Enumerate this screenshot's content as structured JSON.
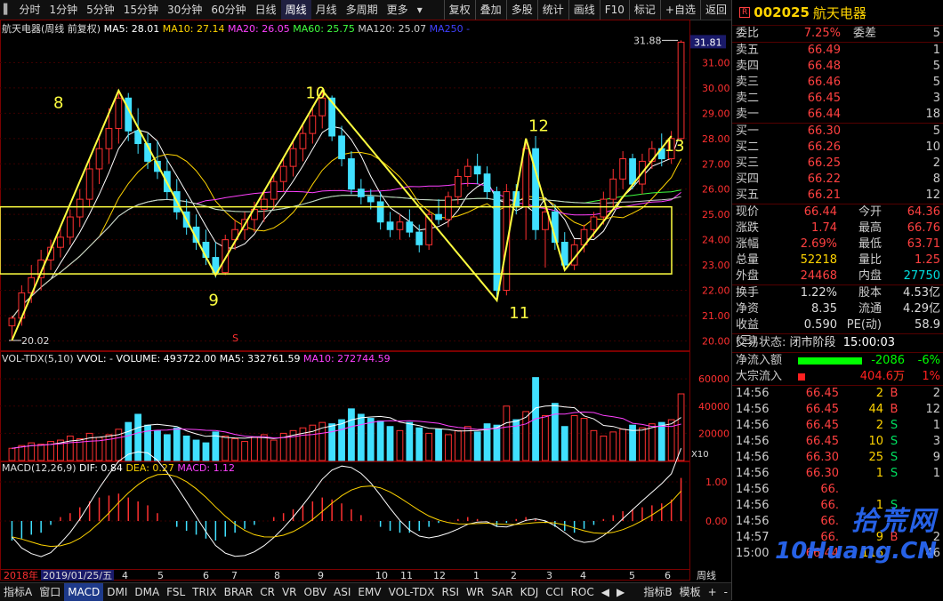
{
  "toolbar": {
    "items": [
      "分时",
      "1分钟",
      "5分钟",
      "15分钟",
      "30分钟",
      "60分钟",
      "日线",
      "周线",
      "月线",
      "多周期",
      "更多"
    ],
    "active": "周线",
    "right": [
      "复权",
      "叠加",
      "多股",
      "统计",
      "画线",
      "F10",
      "标记",
      "+自选",
      "返回"
    ]
  },
  "stock": {
    "code": "002025",
    "name": "航天电器",
    "badge": "R"
  },
  "main_legend": {
    "title": "航天电器(周线 前复权)",
    "items": [
      {
        "label": "MA5: 28.01",
        "color": "#ffffff"
      },
      {
        "label": "MA10: 27.14",
        "color": "#ffd400"
      },
      {
        "label": "MA20: 26.05",
        "color": "#ff40ff"
      },
      {
        "label": "MA60: 25.75",
        "color": "#40ff40"
      },
      {
        "label": "MA120: 25.07",
        "color": "#cccccc"
      },
      {
        "label": "MA250 -",
        "color": "#4040ff"
      }
    ]
  },
  "vol_legend": {
    "title": "VOL-TDX(5,10)",
    "items": [
      {
        "label": "VVOL: -",
        "color": "#ffffff"
      },
      {
        "label": "VOLUME: 493722.00",
        "color": "#ffffff"
      },
      {
        "label": "MA5: 332761.59",
        "color": "#ffffff"
      },
      {
        "label": "MA10: 272744.59",
        "color": "#ff40ff"
      }
    ]
  },
  "macd_legend": {
    "title": "MACD(12,26,9)",
    "items": [
      {
        "label": "DIF: 0.84",
        "color": "#ffffff"
      },
      {
        "label": "DEA: 0.27",
        "color": "#ffd400"
      },
      {
        "label": "MACD: 1.12",
        "color": "#ff40ff"
      }
    ]
  },
  "chart_data": {
    "type": "candlestick",
    "price_axis": {
      "ticks": [
        20,
        21,
        22,
        23,
        24,
        25,
        26,
        27,
        28,
        29,
        30,
        31
      ],
      "max_label": "31.88",
      "min_label": "20.02",
      "current": "31.81"
    },
    "vol_axis": {
      "ticks": [
        "20000",
        "40000",
        "60000"
      ],
      "unit": "X10"
    },
    "macd_axis": {
      "ticks": [
        "0.00",
        "1.00"
      ]
    },
    "x_labels": [
      "2018年",
      "2019/01/25/五",
      "4",
      "5",
      "6",
      "7",
      "8",
      "9",
      "10",
      "11",
      "12",
      "1",
      "2",
      "3",
      "4",
      "5",
      "6"
    ],
    "annotations": [
      "8",
      "9",
      "10",
      "11",
      "12",
      "13"
    ],
    "marker": "S",
    "candles": [
      [
        20.6,
        21.0,
        20.0,
        20.9
      ],
      [
        20.9,
        22.2,
        20.6,
        21.9
      ],
      [
        21.9,
        23.0,
        21.5,
        22.5
      ],
      [
        22.5,
        23.6,
        22.0,
        23.2
      ],
      [
        23.2,
        24.0,
        22.8,
        23.7
      ],
      [
        23.7,
        24.5,
        23.3,
        24.1
      ],
      [
        24.1,
        25.2,
        23.8,
        24.9
      ],
      [
        24.9,
        26.0,
        24.5,
        25.6
      ],
      [
        25.6,
        27.2,
        25.3,
        26.8
      ],
      [
        26.8,
        28.0,
        26.2,
        27.6
      ],
      [
        27.6,
        29.2,
        27.0,
        28.4
      ],
      [
        28.4,
        29.9,
        27.8,
        29.6
      ],
      [
        29.6,
        29.8,
        27.9,
        28.3
      ],
      [
        28.3,
        29.2,
        27.4,
        27.8
      ],
      [
        27.8,
        28.2,
        26.8,
        27.1
      ],
      [
        27.1,
        27.9,
        26.4,
        26.7
      ],
      [
        26.7,
        27.2,
        25.6,
        25.9
      ],
      [
        25.9,
        26.4,
        24.8,
        25.1
      ],
      [
        25.1,
        25.6,
        24.2,
        24.5
      ],
      [
        24.5,
        25.0,
        23.6,
        23.9
      ],
      [
        23.9,
        24.4,
        23.0,
        23.3
      ],
      [
        23.3,
        23.9,
        22.5,
        22.7
      ],
      [
        22.7,
        24.2,
        22.6,
        24.0
      ],
      [
        24.0,
        24.8,
        23.6,
        24.4
      ],
      [
        24.4,
        25.1,
        24.0,
        24.8
      ],
      [
        24.8,
        25.5,
        24.3,
        25.2
      ],
      [
        25.2,
        25.9,
        24.7,
        25.6
      ],
      [
        25.6,
        26.6,
        25.2,
        26.3
      ],
      [
        26.3,
        27.2,
        25.9,
        26.9
      ],
      [
        26.9,
        27.9,
        26.5,
        27.6
      ],
      [
        27.6,
        28.6,
        27.1,
        28.2
      ],
      [
        28.2,
        29.3,
        27.8,
        28.9
      ],
      [
        28.9,
        29.9,
        28.4,
        29.6
      ],
      [
        29.6,
        29.7,
        27.9,
        28.1
      ],
      [
        28.1,
        28.5,
        26.9,
        27.2
      ],
      [
        27.2,
        27.5,
        25.8,
        26.0
      ],
      [
        26.0,
        26.4,
        25.4,
        25.7
      ],
      [
        25.7,
        26.0,
        25.2,
        25.5
      ],
      [
        25.5,
        25.9,
        24.4,
        24.7
      ],
      [
        24.7,
        25.1,
        24.1,
        24.4
      ],
      [
        24.4,
        25.0,
        24.0,
        24.7
      ],
      [
        24.7,
        25.2,
        24.1,
        24.3
      ],
      [
        24.3,
        24.6,
        23.5,
        23.8
      ],
      [
        23.8,
        25.2,
        23.6,
        25.0
      ],
      [
        25.0,
        25.6,
        24.6,
        24.8
      ],
      [
        24.8,
        25.9,
        24.5,
        25.7
      ],
      [
        25.7,
        26.8,
        25.4,
        26.5
      ],
      [
        26.5,
        27.2,
        26.1,
        26.9
      ],
      [
        26.9,
        27.4,
        26.2,
        26.6
      ],
      [
        26.6,
        26.9,
        25.6,
        25.9
      ],
      [
        25.9,
        26.1,
        21.6,
        22.0
      ],
      [
        22.0,
        26.2,
        21.8,
        25.9
      ],
      [
        25.9,
        26.2,
        25.0,
        25.3
      ],
      [
        25.3,
        27.9,
        24.0,
        27.6
      ],
      [
        27.6,
        28.1,
        24.0,
        24.4
      ],
      [
        24.4,
        25.3,
        22.9,
        25.1
      ],
      [
        25.1,
        25.4,
        23.6,
        23.9
      ],
      [
        23.9,
        24.3,
        22.8,
        23.0
      ],
      [
        23.0,
        24.0,
        22.8,
        23.8
      ],
      [
        23.8,
        24.6,
        23.5,
        24.4
      ],
      [
        24.4,
        25.1,
        24.1,
        24.9
      ],
      [
        24.9,
        25.9,
        24.6,
        25.6
      ],
      [
        25.6,
        26.8,
        25.3,
        26.4
      ],
      [
        26.4,
        27.5,
        26.0,
        27.2
      ],
      [
        27.2,
        27.4,
        26.0,
        26.2
      ],
      [
        26.2,
        27.4,
        25.8,
        27.1
      ],
      [
        27.1,
        27.9,
        26.8,
        27.6
      ],
      [
        27.6,
        28.2,
        26.9,
        27.2
      ],
      [
        27.2,
        28.3,
        27.0,
        28.0
      ],
      [
        28.0,
        31.88,
        27.9,
        31.81
      ]
    ],
    "volumes": [
      9,
      11,
      13,
      12,
      14,
      15,
      18,
      16,
      20,
      17,
      19,
      23,
      28,
      34,
      26,
      22,
      19,
      24,
      18,
      15,
      13,
      21,
      18,
      16,
      14,
      17,
      19,
      15,
      20,
      22,
      24,
      26,
      28,
      27,
      30,
      38,
      34,
      31,
      29,
      25,
      22,
      28,
      24,
      20,
      23,
      19,
      22,
      25,
      21,
      27,
      26,
      40,
      30,
      36,
      61,
      33,
      42,
      25,
      33,
      31,
      22,
      18,
      21,
      23,
      26,
      24,
      27,
      28,
      30,
      49
    ],
    "macd_hist": [
      -0.5,
      -0.45,
      -0.35,
      -0.3,
      -0.1,
      0.1,
      0.2,
      0.35,
      0.5,
      0.6,
      0.65,
      0.7,
      0.6,
      0.5,
      0.4,
      0.2,
      0.0,
      -0.15,
      -0.25,
      -0.35,
      -0.45,
      -0.5,
      -0.4,
      -0.3,
      -0.2,
      -0.1,
      0.0,
      0.1,
      0.2,
      0.3,
      0.4,
      0.5,
      0.6,
      0.55,
      0.45,
      0.3,
      0.15,
      0.0,
      -0.15,
      -0.25,
      -0.3,
      -0.3,
      -0.25,
      -0.15,
      -0.05,
      0.0,
      0.05,
      0.1,
      0.05,
      0.0,
      -0.15,
      -0.05,
      0.05,
      0.1,
      0.05,
      -0.05,
      -0.15,
      -0.25,
      -0.3,
      -0.2,
      -0.1,
      0.05,
      0.15,
      0.25,
      0.3,
      0.35,
      0.4,
      0.45,
      0.55,
      1.1
    ]
  },
  "panel": {
    "weibi": {
      "label": "委比",
      "value": "7.25%",
      "label2": "委差",
      "value2": "5"
    },
    "sell": [
      [
        "卖五",
        "66.49",
        "1"
      ],
      [
        "卖四",
        "66.48",
        "5"
      ],
      [
        "卖三",
        "66.46",
        "5"
      ],
      [
        "卖二",
        "66.45",
        "3"
      ],
      [
        "卖一",
        "66.44",
        "18"
      ]
    ],
    "buy": [
      [
        "买一",
        "66.30",
        "5"
      ],
      [
        "买二",
        "66.26",
        "10"
      ],
      [
        "买三",
        "66.25",
        "2"
      ],
      [
        "买四",
        "66.22",
        "8"
      ],
      [
        "买五",
        "66.21",
        "12"
      ]
    ],
    "quote": [
      [
        "现价",
        "66.44",
        "今开",
        "64.36"
      ],
      [
        "涨跌",
        "1.74",
        "最高",
        "66.76"
      ],
      [
        "涨幅",
        "2.69%",
        "最低",
        "63.71"
      ],
      [
        "总量",
        "52218",
        "量比",
        "1.25"
      ],
      [
        "外盘",
        "24468",
        "内盘",
        "27750"
      ]
    ],
    "finance": [
      [
        "换手",
        "1.22%",
        "股本",
        "4.53亿"
      ],
      [
        "净资",
        "8.35",
        "流通",
        "4.29亿"
      ],
      [
        "收益(三)",
        "0.590",
        "PE(动)",
        "58.9"
      ]
    ],
    "status": {
      "label": "交易状态:",
      "value": "闭市阶段",
      "time": "15:00:03"
    },
    "flow": [
      {
        "label": "净流入额",
        "value": "-2086万",
        "pct": "-6%",
        "color": "#00ff00"
      },
      {
        "label": "大宗流入",
        "value": "404.6万",
        "pct": "1%",
        "color": "#ff2020"
      }
    ],
    "trades": [
      [
        "14:56",
        "66.45",
        "2",
        "B",
        "2"
      ],
      [
        "14:56",
        "66.45",
        "44",
        "B",
        "12"
      ],
      [
        "14:56",
        "66.45",
        "2",
        "S",
        "1"
      ],
      [
        "14:56",
        "66.45",
        "10",
        "S",
        "3"
      ],
      [
        "14:56",
        "66.30",
        "25",
        "S",
        "9"
      ],
      [
        "14:56",
        "66.30",
        "1",
        "S",
        "1"
      ],
      [
        "14:56",
        "66.",
        "",
        "",
        ""
      ],
      [
        "14:56",
        "66.",
        "1",
        "S",
        ""
      ],
      [
        "14:56",
        "66.",
        "",
        "",
        ""
      ],
      [
        "14:57",
        "66.",
        "9",
        "B",
        "2"
      ],
      [
        "15:00",
        "66.44",
        "116",
        "",
        "46"
      ]
    ]
  },
  "bottom": {
    "items": [
      "指标A",
      "窗口",
      "MACD",
      "DMI",
      "DMA",
      "FSL",
      "TRIX",
      "BRAR",
      "CR",
      "VR",
      "OBV",
      "ASI",
      "EMV",
      "VOL-TDX",
      "RSI",
      "WR",
      "SAR",
      "KDJ",
      "CCI",
      "ROC"
    ],
    "active": "MACD",
    "right": [
      "指标B",
      "模板",
      "+",
      "-"
    ],
    "period_label": "周线"
  },
  "watermark": {
    "text1": "拾荒网",
    "text2": "10Huang.CN"
  }
}
